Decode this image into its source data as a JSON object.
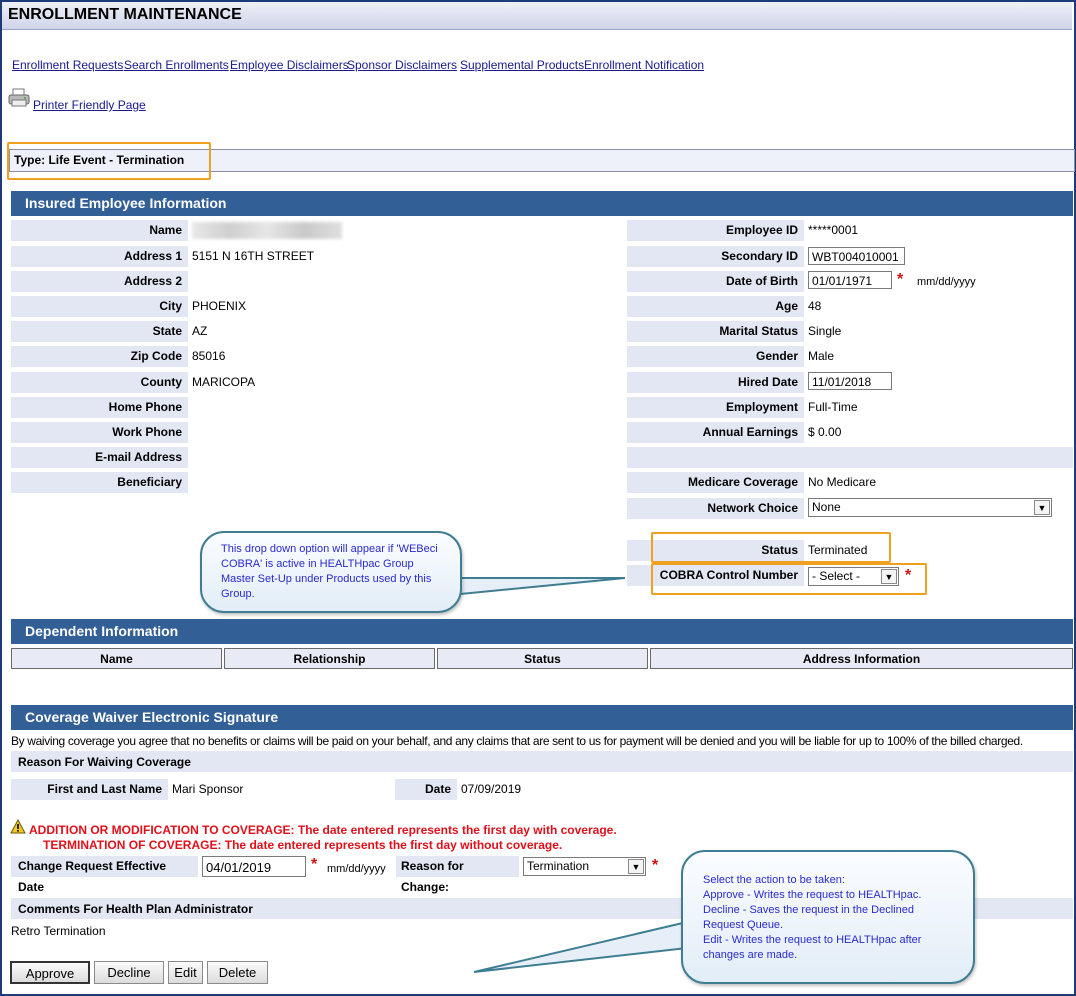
{
  "header": {
    "title": "ENROLLMENT MAINTENANCE"
  },
  "nav": [
    "Enrollment Requests",
    "Search Enrollments",
    "Employee Disclaimers",
    "Sponsor Disclaimers",
    "Supplemental Products",
    "Enrollment Notification"
  ],
  "printer_link": "Printer Friendly Page",
  "type_label": "Type:  Life Event - Termination",
  "employee_section": {
    "title": "Insured Employee Information",
    "left": [
      {
        "label": "Name",
        "value": ""
      },
      {
        "label": "Address 1",
        "value": "5151 N 16TH STREET"
      },
      {
        "label": "Address 2",
        "value": ""
      },
      {
        "label": "City",
        "value": "PHOENIX"
      },
      {
        "label": "State",
        "value": "AZ"
      },
      {
        "label": "Zip Code",
        "value": "85016"
      },
      {
        "label": "County",
        "value": "MARICOPA"
      },
      {
        "label": "Home Phone",
        "value": ""
      },
      {
        "label": "Work Phone",
        "value": ""
      },
      {
        "label": "E-mail Address",
        "value": ""
      },
      {
        "label": "Beneficiary",
        "value": ""
      }
    ],
    "right": {
      "employee_id": {
        "label": "Employee ID",
        "value": "*****0001"
      },
      "secondary_id": {
        "label": "Secondary ID",
        "value": "WBT004010001"
      },
      "dob": {
        "label": "Date of Birth",
        "value": "01/01/1971",
        "hint": "mm/dd/yyyy"
      },
      "age": {
        "label": "Age",
        "value": "48"
      },
      "marital": {
        "label": "Marital Status",
        "value": "Single"
      },
      "gender": {
        "label": "Gender",
        "value": "Male"
      },
      "hired": {
        "label": "Hired Date",
        "value": "11/01/2018"
      },
      "employment": {
        "label": "Employment",
        "value": "Full-Time"
      },
      "earnings": {
        "label": "Annual Earnings",
        "value": "$ 0.00"
      },
      "medicare": {
        "label": "Medicare Coverage",
        "value": "No Medicare"
      },
      "network": {
        "label": "Network Choice",
        "value": "None"
      },
      "status": {
        "label": "Status",
        "value": "Terminated"
      },
      "cobra": {
        "label": "COBRA Control Number",
        "value": "- Select -"
      }
    }
  },
  "callout_cobra": "This drop down option will appear if 'WEBeci COBRA' is active in HEALTHpac Group Master Set-Up under Products used by this Group.",
  "dependent_section": {
    "title": "Dependent Information",
    "columns": [
      "Name",
      "Relationship",
      "Status",
      "Address Information"
    ]
  },
  "waiver_section": {
    "title": "Coverage Waiver Electronic Signature",
    "disclaimer": "By waiving coverage you agree that no benefits or claims will be paid on your behalf, and any claims that are sent to us for payment will be denied and you will be liable for up to 100% of the billed charged.",
    "reason_header": "Reason For Waiving Coverage",
    "name_label": "First and Last Name",
    "name_value": "Mari Sponsor",
    "date_label": "Date",
    "date_value": "07/09/2019"
  },
  "warning": {
    "line1": "ADDITION OR MODIFICATION TO COVERAGE:  The date entered represents the first day with coverage.",
    "line2": "TERMINATION OF COVERAGE:  The date entered represents the first day without coverage."
  },
  "change_request": {
    "label": "Change Request Effective Date",
    "value": "04/01/2019",
    "hint": "mm/dd/yyyy",
    "reason_label": "Reason for Change:",
    "reason_value": "Termination"
  },
  "comments": {
    "label": "Comments For Health Plan Administrator",
    "value": "Retro Termination"
  },
  "callout_actions": {
    "line1": "Select the action to be taken:",
    "line2": "Approve - Writes the request to HEALTHpac.",
    "line3": "Decline - Saves the request in the Declined Request Queue.",
    "line4": "Edit - Writes the request to HEALTHpac after changes are made."
  },
  "buttons": {
    "approve": "Approve",
    "decline": "Decline",
    "edit": "Edit",
    "delete": "Delete"
  }
}
